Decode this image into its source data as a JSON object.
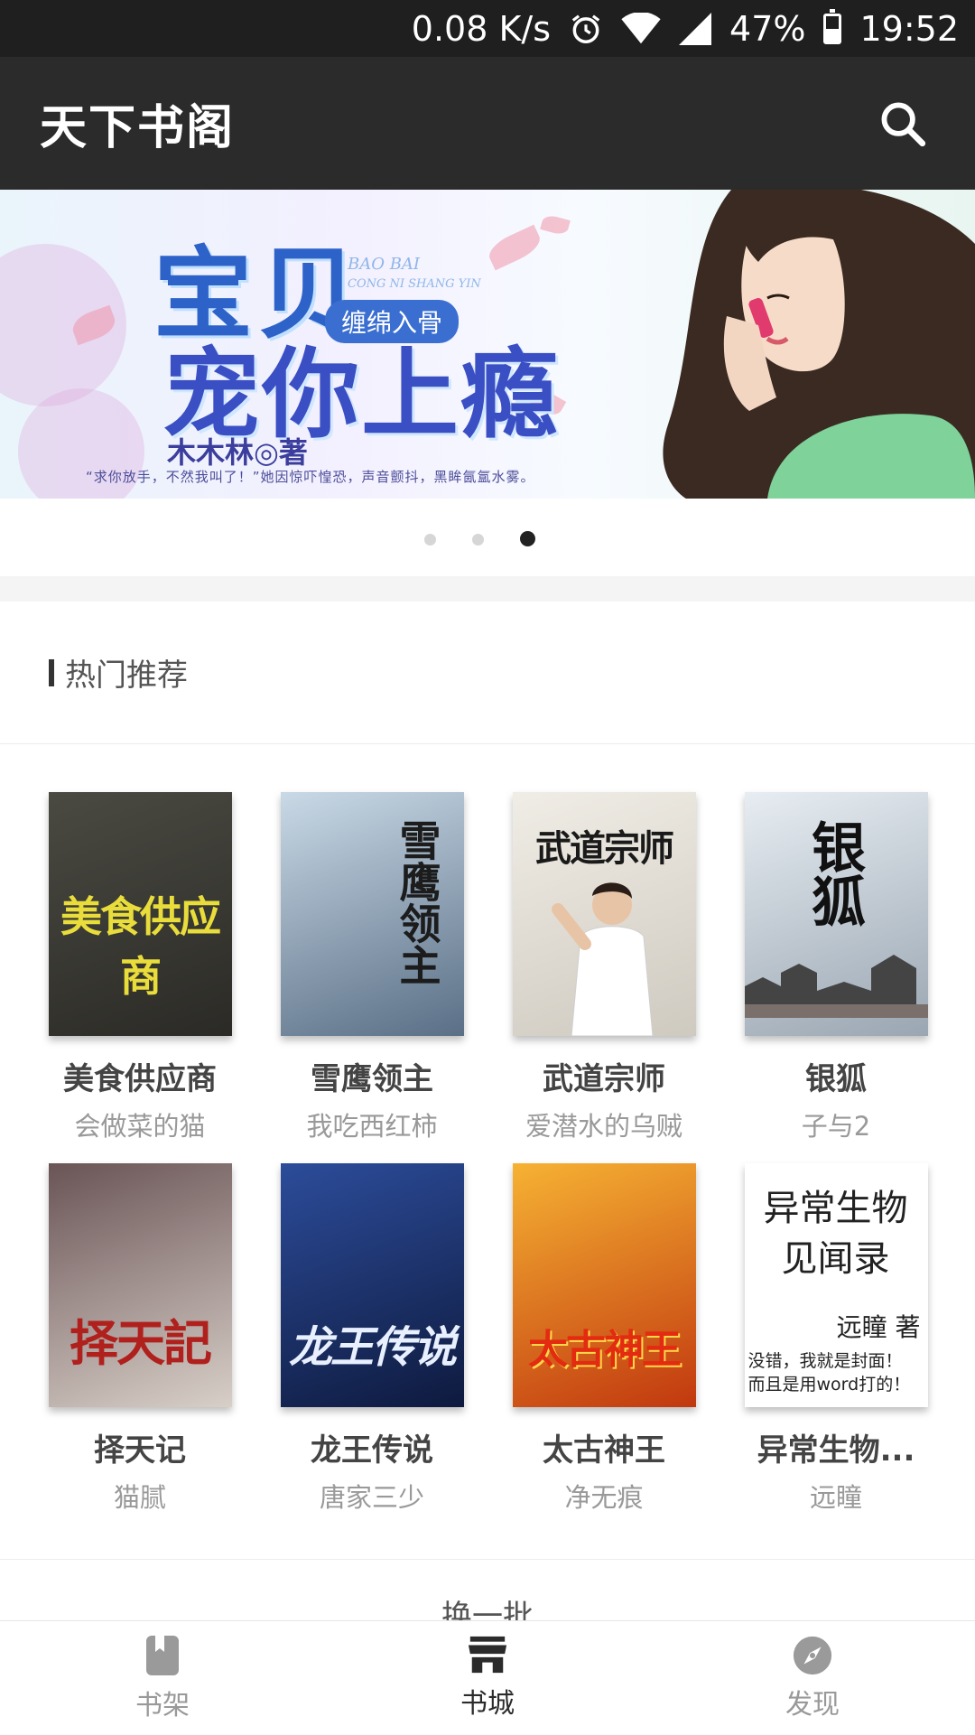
{
  "status_bar": {
    "speed": "0.08 K/s",
    "battery": "47%",
    "battery_level": 0.47,
    "time": "19:52",
    "icons": [
      "alarm-icon",
      "wifi-icon",
      "signal-icon",
      "battery-icon"
    ]
  },
  "app_bar": {
    "title": "天下书阁",
    "search_icon": "search-icon"
  },
  "banner": {
    "title_line1": "宝贝",
    "title_line2": "宠你上瘾",
    "pinyin_line1": "BAO BAI",
    "pinyin_line2": "CONG NI SHANG YIN",
    "tag": "缠绵入骨",
    "author": "木木林◎著",
    "quote": "“求你放手，不然我叫了！”她因惊吓惶恐，声音颤抖，黑眸氤氲水雾。",
    "page_count": 3,
    "active_page": 3
  },
  "section": {
    "title": "热门推荐"
  },
  "books": [
    {
      "title": "美食供应商",
      "author": "会做菜的猫",
      "cover_text": "美食供应商",
      "colors": [
        "#4a4a42",
        "#2b2a26"
      ],
      "text_color": "#e9dd3b"
    },
    {
      "title": "雪鹰领主",
      "author": "我吃西红柿",
      "cover_text": "雪鹰领主",
      "colors": [
        "#c9d9e6",
        "#5a6f86"
      ],
      "text_color": "#1c1c1c"
    },
    {
      "title": "武道宗师",
      "author": "爱潜水的乌贼",
      "cover_text": "武道宗师",
      "colors": [
        "#f0ede6",
        "#cfcac0"
      ],
      "text_color": "#1a1a1a"
    },
    {
      "title": "银狐",
      "author": "子与2",
      "cover_text": "银狐",
      "colors": [
        "#e7edf2",
        "#9aa6b2"
      ],
      "text_color": "#111"
    },
    {
      "title": "择天记",
      "author": "猫腻",
      "cover_text": "择天記",
      "colors": [
        "#6a5456",
        "#d8cfc8"
      ],
      "text_color": "#b0201c"
    },
    {
      "title": "龙王传说",
      "author": "唐家三少",
      "cover_text": "龙王传说",
      "colors": [
        "#2c4c9a",
        "#0e1a3e"
      ],
      "text_color": "#e8f0ff"
    },
    {
      "title": "太古神王",
      "author": "净无痕",
      "cover_text": "太古神王",
      "colors": [
        "#f6b233",
        "#c1380f"
      ],
      "text_color": "#e22b10"
    },
    {
      "title": "异常生物...",
      "author": "远瞳",
      "cover_text": "异常生物见闻录",
      "colors": [
        "#ffffff",
        "#ffffff"
      ],
      "text_color": "#222"
    }
  ],
  "cover_extra": {
    "author_sign": "远瞳 著",
    "note_line1": "没错，我就是封面！",
    "note_line2": "而且是用word打的！"
  },
  "refresh_label": "换一批",
  "nav": [
    {
      "label": "书架",
      "icon": "book-icon",
      "active": false
    },
    {
      "label": "书城",
      "icon": "store-icon",
      "active": true
    },
    {
      "label": "发现",
      "icon": "compass-icon",
      "active": false
    }
  ]
}
